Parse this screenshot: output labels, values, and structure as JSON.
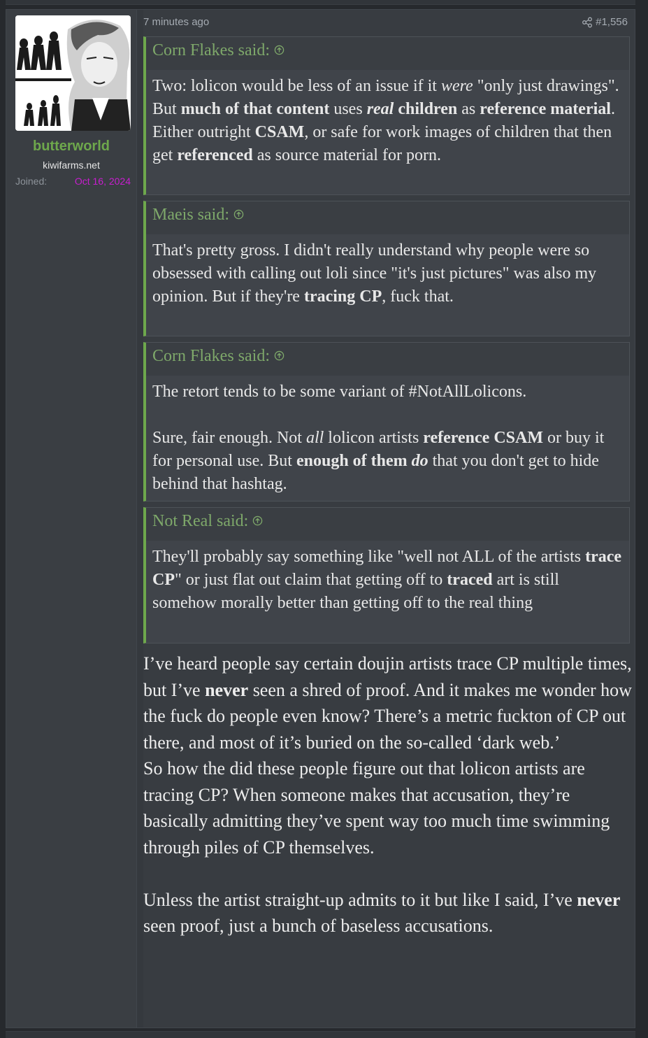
{
  "user": {
    "username": "butterworld",
    "title": "kiwifarms.net",
    "joined_label": "Joined:",
    "joined_date": "Oct 16, 2024"
  },
  "post": {
    "time": "7 minutes ago",
    "number": "#1,556",
    "quotes": [
      {
        "author_line": "Corn Flakes said:",
        "body_html": "Two: lolicon would be less of an issue if it <i>were</i> \"only just drawings\". But <b>much of that content</b> uses <b><i>real</i> children</b> as <b>reference material</b>. Either outright <b>CSAM</b>, or safe for work images of children that then get <b>referenced</b> as source material for porn."
      },
      {
        "author_line": "Maeis said:",
        "body_html": "That's pretty gross. I didn't really understand why people were so obsessed with calling out loli since \"it's just pictures\" was also my opinion. But if they're <b>tracing CP</b>, fuck that."
      },
      {
        "author_line": "Corn Flakes said:",
        "body_html": "The retort tends to be some variant of #NotAllLolicons.<br><br>Sure, fair enough. Not <i>all</i> lolicon artists <b>reference CSAM</b> or buy it for personal use. But <b>enough of them <i>do</i></b> that you don't get to hide behind that hashtag."
      },
      {
        "author_line": "Not Real said:",
        "body_html": "They'll probably say something like \"well not ALL of the artists <b>trace CP</b>\" or just flat out claim that getting off to <b>traced</b> art is still somehow morally better than getting off to the real thing"
      }
    ],
    "body_paragraphs_html": [
      "I’ve heard people say certain doujin artists trace CP multiple times, but I’ve <b>never</b> seen a shred of proof. And it makes me wonder how the fuck do people even know? There’s a metric fuckton of CP out there, and most of it’s buried on the so-called ‘dark web.’",
      "So how the did these people figure out that lolicon artists are tracing CP? When someone makes that accusation, they’re basically admitting they’ve spent way too much time swimming through piles of CP themselves.",
      "",
      "Unless the artist straight-up admits to it but like I said, I’ve <b>never</b> seen proof, just a bunch of baseless accusations."
    ]
  },
  "icons": {
    "share": "share-icon",
    "quote_jump": "arrow-up-circle-icon",
    "avatar": "evolution-anime-avatar"
  },
  "colors": {
    "username": "#6ea84c",
    "joined_date": "#c81ecf",
    "quote_border": "#6ea84c"
  }
}
